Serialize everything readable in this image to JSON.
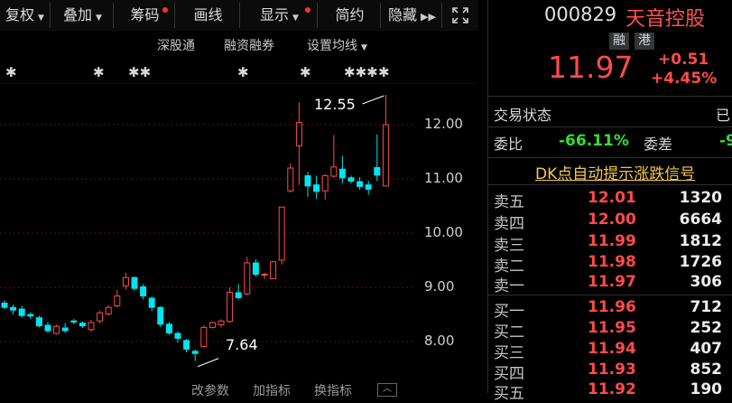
{
  "toolbar": {
    "items": [
      {
        "label": "复权",
        "has_arrow": true,
        "has_dot": false
      },
      {
        "label": "叠加",
        "has_arrow": true,
        "has_dot": false
      },
      {
        "label": "筹码",
        "has_arrow": false,
        "has_dot": true
      },
      {
        "label": "画线",
        "has_arrow": false,
        "has_dot": false
      },
      {
        "label": "显示",
        "has_arrow": true,
        "has_dot": true
      },
      {
        "label": "简约",
        "has_arrow": false,
        "has_dot": false
      },
      {
        "label": "隐藏",
        "has_arrow": false,
        "has_dot": false
      }
    ],
    "more_icon": "double-chevron-right-icon",
    "fullscreen_icon": "fullscreen-icon"
  },
  "subbar": {
    "shenzhen_link": "深股通",
    "margin": "融资融券",
    "settings": "设置均线"
  },
  "chart_data": {
    "type": "candlestick",
    "ylim": [
      7.4,
      12.9
    ],
    "yticks": [
      "12.00",
      "11.00",
      "10.00",
      "9.00",
      "8.00"
    ],
    "annotations": [
      "12.55",
      "7.64"
    ],
    "candles": [
      {
        "o": 8.71,
        "c": 8.63,
        "h": 8.76,
        "l": 8.6
      },
      {
        "o": 8.63,
        "c": 8.58,
        "h": 8.68,
        "l": 8.5
      },
      {
        "o": 8.6,
        "c": 8.48,
        "h": 8.66,
        "l": 8.44
      },
      {
        "o": 8.5,
        "c": 8.47,
        "h": 8.54,
        "l": 8.42
      },
      {
        "o": 8.44,
        "c": 8.29,
        "h": 8.48,
        "l": 8.26
      },
      {
        "o": 8.3,
        "c": 8.2,
        "h": 8.36,
        "l": 8.16
      },
      {
        "o": 8.15,
        "c": 8.28,
        "h": 8.31,
        "l": 8.13
      },
      {
        "o": 8.25,
        "c": 8.2,
        "h": 8.34,
        "l": 8.16
      },
      {
        "o": 8.38,
        "c": 8.36,
        "h": 8.42,
        "l": 8.32
      },
      {
        "o": 8.34,
        "c": 8.29,
        "h": 8.37,
        "l": 8.25
      },
      {
        "o": 8.22,
        "c": 8.35,
        "h": 8.4,
        "l": 8.18
      },
      {
        "o": 8.38,
        "c": 8.53,
        "h": 8.57,
        "l": 8.34
      },
      {
        "o": 8.51,
        "c": 8.63,
        "h": 8.67,
        "l": 8.48
      },
      {
        "o": 8.66,
        "c": 8.84,
        "h": 8.95,
        "l": 8.63
      },
      {
        "o": 9.03,
        "c": 9.18,
        "h": 9.27,
        "l": 8.96
      },
      {
        "o": 9.18,
        "c": 8.98,
        "h": 9.2,
        "l": 8.94
      },
      {
        "o": 9.01,
        "c": 8.84,
        "h": 9.06,
        "l": 8.78
      },
      {
        "o": 8.8,
        "c": 8.63,
        "h": 8.83,
        "l": 8.56
      },
      {
        "o": 8.63,
        "c": 8.32,
        "h": 8.65,
        "l": 8.27
      },
      {
        "o": 8.32,
        "c": 8.16,
        "h": 8.36,
        "l": 8.12
      },
      {
        "o": 8.15,
        "c": 8.06,
        "h": 8.19,
        "l": 7.98
      },
      {
        "o": 8.02,
        "c": 7.86,
        "h": 8.05,
        "l": 7.8
      },
      {
        "o": 7.82,
        "c": 7.78,
        "h": 7.85,
        "l": 7.64
      },
      {
        "o": 7.91,
        "c": 8.26,
        "h": 8.3,
        "l": 7.89
      },
      {
        "o": 8.26,
        "c": 8.35,
        "h": 8.37,
        "l": 8.24
      },
      {
        "o": 8.31,
        "c": 8.38,
        "h": 8.41,
        "l": 8.26
      },
      {
        "o": 8.37,
        "c": 8.91,
        "h": 9.0,
        "l": 8.34
      },
      {
        "o": 8.9,
        "c": 8.81,
        "h": 9.06,
        "l": 8.78
      },
      {
        "o": 8.88,
        "c": 9.45,
        "h": 9.56,
        "l": 8.85
      },
      {
        "o": 9.45,
        "c": 9.24,
        "h": 9.52,
        "l": 9.2
      },
      {
        "o": 9.23,
        "c": 9.24,
        "h": 9.27,
        "l": 9.15
      },
      {
        "o": 9.16,
        "c": 9.47,
        "h": 9.48,
        "l": 9.15
      },
      {
        "o": 9.5,
        "c": 10.48,
        "h": 10.48,
        "l": 9.42
      },
      {
        "o": 10.78,
        "c": 11.2,
        "h": 11.29,
        "l": 10.75
      },
      {
        "o": 11.61,
        "c": 12.04,
        "h": 12.41,
        "l": 10.89
      },
      {
        "o": 11.06,
        "c": 10.87,
        "h": 11.13,
        "l": 10.67
      },
      {
        "o": 10.89,
        "c": 10.77,
        "h": 11.06,
        "l": 10.63
      },
      {
        "o": 10.78,
        "c": 11.06,
        "h": 11.09,
        "l": 10.62
      },
      {
        "o": 11.05,
        "c": 11.22,
        "h": 11.81,
        "l": 11.02
      },
      {
        "o": 11.18,
        "c": 11.02,
        "h": 11.42,
        "l": 10.92
      },
      {
        "o": 11.02,
        "c": 10.96,
        "h": 11.06,
        "l": 10.91
      },
      {
        "o": 10.95,
        "c": 10.86,
        "h": 11.03,
        "l": 10.8
      },
      {
        "o": 10.89,
        "c": 10.81,
        "h": 10.97,
        "l": 10.71
      },
      {
        "o": 11.21,
        "c": 11.07,
        "h": 11.82,
        "l": 10.96
      },
      {
        "o": 10.87,
        "c": 12.0,
        "h": 12.55,
        "l": 10.86
      }
    ]
  },
  "right": {
    "code": "000829",
    "name": "天音控股",
    "badges": [
      "融",
      "港"
    ],
    "price": "11.97",
    "change": "+0.51",
    "change_pct": "+4.45%",
    "status_label": "交易状态",
    "status_value": "已",
    "ratio_label": "委比",
    "ratio_value": "-66.11%",
    "diff_label": "委差",
    "diff_value": "-9",
    "dk_link": "DK点自动提示涨跌信号",
    "asks": [
      {
        "label": "卖五",
        "price": "12.01",
        "vol": "1320"
      },
      {
        "label": "卖四",
        "price": "12.00",
        "vol": "6664"
      },
      {
        "label": "卖三",
        "price": "11.99",
        "vol": "1812"
      },
      {
        "label": "卖二",
        "price": "11.98",
        "vol": "1726"
      },
      {
        "label": "卖一",
        "price": "11.97",
        "vol": "306"
      }
    ],
    "bids": [
      {
        "label": "买一",
        "price": "11.96",
        "vol": "712"
      },
      {
        "label": "买二",
        "price": "11.95",
        "vol": "252"
      },
      {
        "label": "买三",
        "price": "11.94",
        "vol": "407"
      },
      {
        "label": "买四",
        "price": "11.93",
        "vol": "852"
      },
      {
        "label": "买五",
        "price": "11.92",
        "vol": "190"
      }
    ]
  },
  "bottom_tabs": [
    "改参数",
    "加指标",
    "换指标"
  ],
  "colors": {
    "up": "#ff4b4b",
    "down": "#00e5ee",
    "ratio": "#33dd33"
  }
}
